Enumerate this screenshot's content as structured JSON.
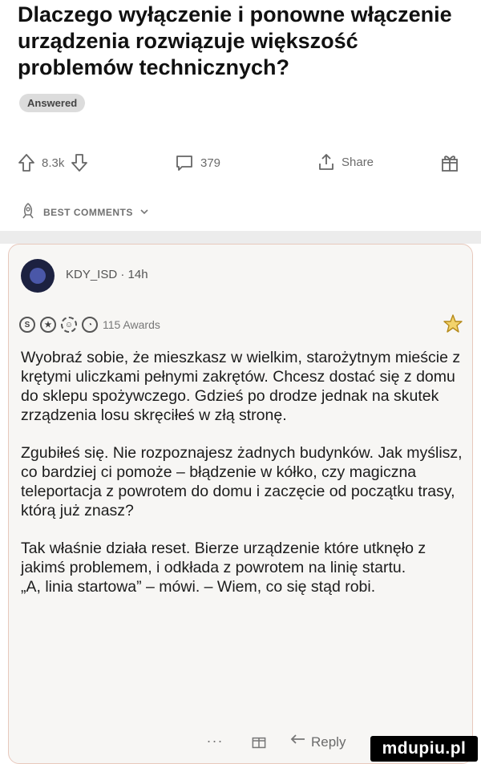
{
  "post": {
    "title": "Dlaczego wyłączenie i ponowne włączenie urządzenia rozwiązuje większość problemów technicznych?",
    "badge": "Answered"
  },
  "actions": {
    "upvotes": "8.3k",
    "comments": "379",
    "share": "Share"
  },
  "sort": {
    "label": "BEST COMMENTS"
  },
  "comment": {
    "user": "KDY_ISD · 14h",
    "awards_label": "115 Awards",
    "paragraphs": [
      "Wyobraź sobie, że mieszkasz w wielkim, starożytnym mieście z krętymi uliczkami pełnymi zakrętów. Chcesz dostać się z domu do sklepu spożywczego. Gdzieś po drodze jednak na skutek zrządzenia losu skręciłeś w złą stronę.",
      "Zgubiłeś się. Nie rozpoznajesz żadnych budynków. Jak myślisz, co bardziej ci pomoże – błądzenie w kółko, czy magiczna teleportacja z powrotem do domu i zaczęcie od początku trasy, którą już znasz?",
      "Tak właśnie działa reset. Bierze urządzenie które utknęło z jakimś problemem, i odkłada z powrotem na linię startu.\n„A, linia startowa” – mówi. – Wiem, co się stąd robi."
    ],
    "more": "...",
    "reply": "Reply"
  },
  "watermark": "mdupiu.pl"
}
